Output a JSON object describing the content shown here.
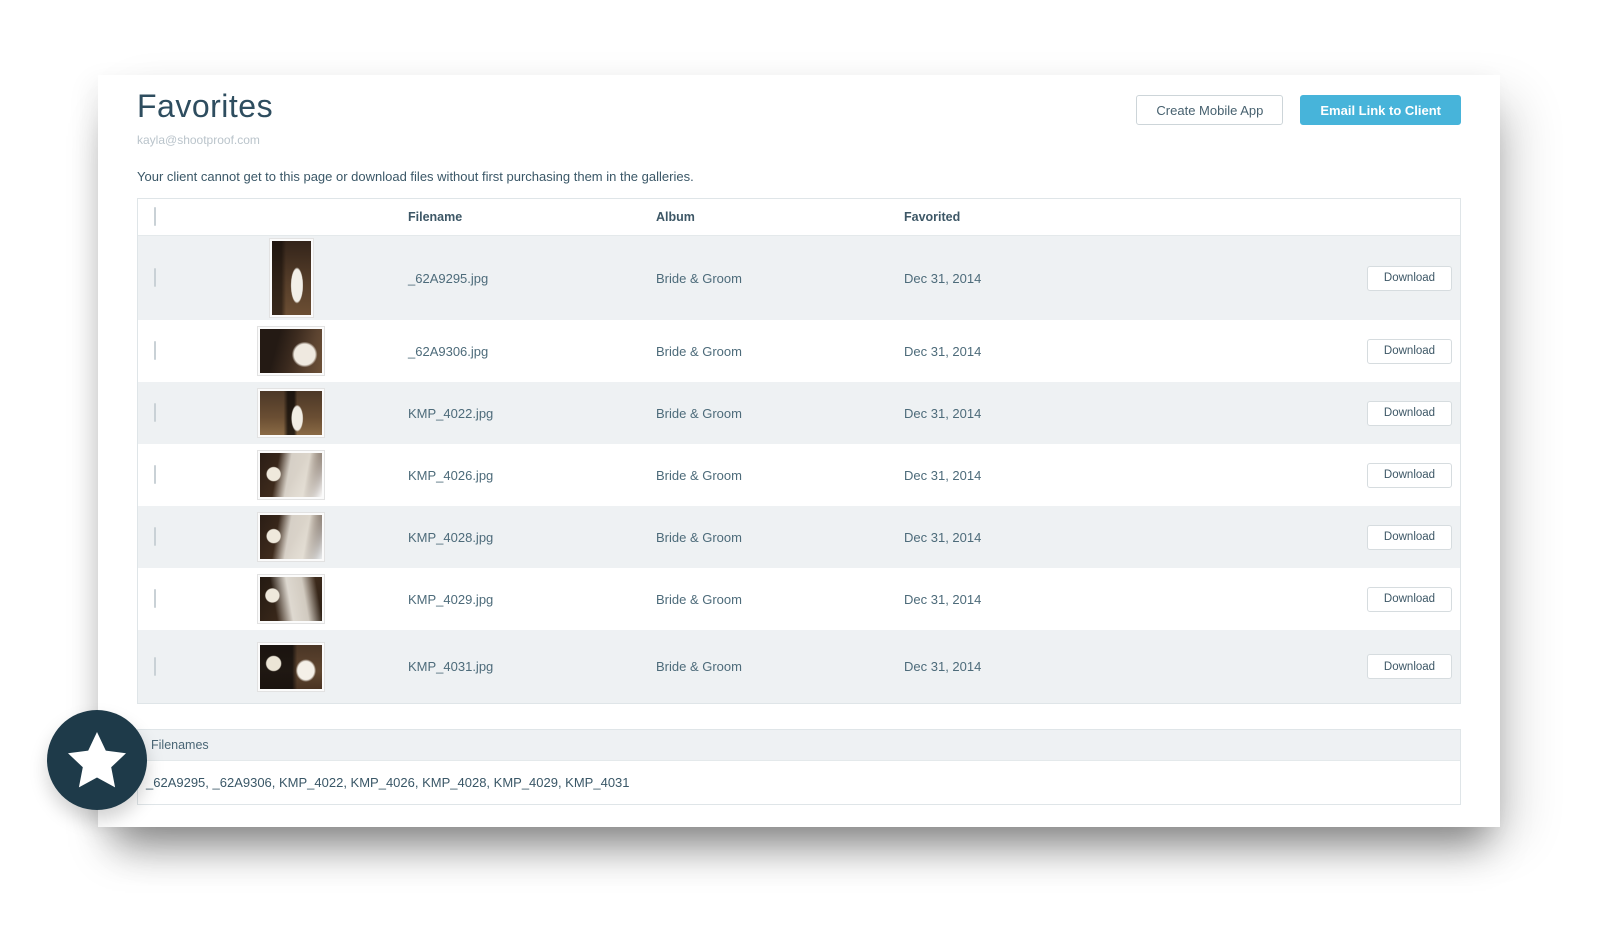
{
  "page": {
    "title": "Favorites",
    "subtitle": "kayla@shootproof.com",
    "note": "Your client cannot get to this page or download files without first purchasing them in the galleries."
  },
  "actions": {
    "create_mobile_app": "Create Mobile App",
    "email_link_to_client": "Email Link to Client"
  },
  "table": {
    "columns": {
      "filename": "Filename",
      "album": "Album",
      "favorited": "Favorited"
    },
    "download_label": "Download",
    "rows": [
      {
        "filename": "_62A9295.jpg",
        "album": "Bride & Groom",
        "favorited": "Dec 31, 2014",
        "thumb": "wedding-photo-portrait"
      },
      {
        "filename": "_62A9306.jpg",
        "album": "Bride & Groom",
        "favorited": "Dec 31, 2014",
        "thumb": "wedding-photo-landscape"
      },
      {
        "filename": "KMP_4022.jpg",
        "album": "Bride & Groom",
        "favorited": "Dec 31, 2014",
        "thumb": "wedding-photo-landscape"
      },
      {
        "filename": "KMP_4026.jpg",
        "album": "Bride & Groom",
        "favorited": "Dec 31, 2014",
        "thumb": "wedding-photo-landscape"
      },
      {
        "filename": "KMP_4028.jpg",
        "album": "Bride & Groom",
        "favorited": "Dec 31, 2014",
        "thumb": "wedding-photo-landscape"
      },
      {
        "filename": "KMP_4029.jpg",
        "album": "Bride & Groom",
        "favorited": "Dec 31, 2014",
        "thumb": "wedding-photo-landscape"
      },
      {
        "filename": "KMP_4031.jpg",
        "album": "Bride & Groom",
        "favorited": "Dec 31, 2014",
        "thumb": "wedding-photo-landscape"
      }
    ]
  },
  "filenames_panel": {
    "header": "Filenames",
    "list": "_62A9295, _62A9306, KMP_4022, KMP_4026, KMP_4028, KMP_4029, KMP_4031"
  },
  "badge": {
    "icon": "star-icon"
  },
  "colors": {
    "accent_blue": "#47b4da",
    "title_text": "#2e4d5f",
    "badge_bg": "#1e3a49",
    "row_stripe": "#eef1f3",
    "table_border": "#dfe5e8"
  }
}
